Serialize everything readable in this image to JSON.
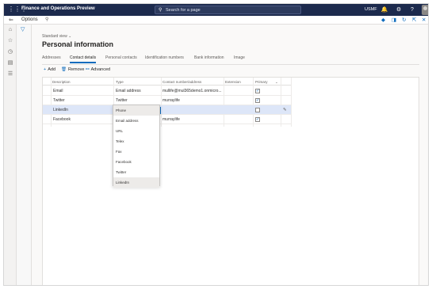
{
  "app": {
    "title": "Finance and Operations Preview",
    "search_placeholder": "Search for a page",
    "company": "USMF"
  },
  "icons": {
    "waffle": "⋮⋮⋮",
    "search": "⚲",
    "bell": "🔔",
    "gear": "⚙",
    "help": "?",
    "back": "⇐",
    "filter": "▽",
    "home": "⌂",
    "star": "☆",
    "clock": "◷",
    "modules": "▤",
    "list": "☰",
    "diamond": "◆",
    "office": "◨",
    "refresh": "↻",
    "popout": "⇱",
    "close": "✕",
    "plus": "+",
    "trash": "🗑",
    "advanced": "⚯",
    "checkmark": "✓",
    "chevron": "⌄",
    "edit": "✎"
  },
  "actionbar": {
    "options_label": "Options"
  },
  "page": {
    "view_selector": "Standard view",
    "title": "Personal information"
  },
  "tabs": [
    {
      "label": "Addresses"
    },
    {
      "label": "Contact details",
      "active": true
    },
    {
      "label": "Personal contacts"
    },
    {
      "label": "Identification numbers"
    },
    {
      "label": "Bank information"
    },
    {
      "label": "Image"
    }
  ],
  "toolbar": {
    "add": "Add",
    "remove": "Remove",
    "advanced": "Advanced"
  },
  "grid": {
    "columns": [
      "Description",
      "Type",
      "Contact number/address",
      "Extension",
      "Primary"
    ],
    "rows": [
      {
        "description": "Email",
        "type": "Email address",
        "contact": "mullife@mul365demo1.onmicro...",
        "extension": "",
        "primary": true
      },
      {
        "description": "Twitter",
        "type": "Twitter",
        "contact": "murraylife",
        "extension": "",
        "primary": true
      },
      {
        "description": "LinkedIn",
        "type": "Phone",
        "contact": "",
        "extension": "",
        "primary": false,
        "selected": true
      },
      {
        "description": "Facebook",
        "type": "",
        "contact": "murraylife",
        "extension": "",
        "primary": true
      }
    ]
  },
  "type_dropdown": {
    "options": [
      "Phone",
      "Email address",
      "URL",
      "Telex",
      "Fax",
      "Facebook",
      "Twitter",
      "LinkedIn"
    ],
    "highlighted": [
      "Phone",
      "LinkedIn"
    ]
  }
}
